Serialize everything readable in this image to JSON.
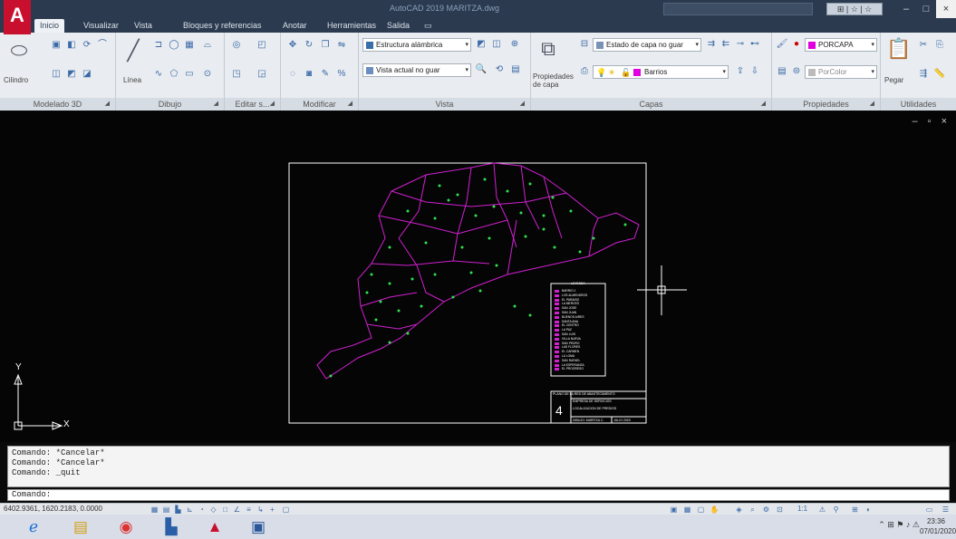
{
  "window": {
    "title": "AutoCAD 2019 MARITZA.dwg",
    "app_logo": "A",
    "minimize": "–",
    "maximize": "□",
    "close": "×",
    "search_placeholder": "",
    "help_icons": "⊞ | ☆ | ☆"
  },
  "tabs": [
    {
      "label": "Inicio",
      "active": true
    },
    {
      "label": "Visualizar",
      "active": false
    },
    {
      "label": "Vista",
      "active": false
    },
    {
      "label": "Bloques y referencias",
      "active": false
    },
    {
      "label": "Anotar",
      "active": false
    },
    {
      "label": "Herramientas",
      "active": false
    },
    {
      "label": "Salida",
      "active": false
    },
    {
      "label": "▭",
      "active": false
    }
  ],
  "ribbon": {
    "panels": [
      {
        "title": "Modelado 3D"
      },
      {
        "title": "Dibujo"
      },
      {
        "title": "Editar s..."
      },
      {
        "title": "Modificar"
      },
      {
        "title": "Vista"
      },
      {
        "title": "Capas"
      },
      {
        "title": "Propiedades"
      },
      {
        "title": "Utilidades"
      }
    ],
    "cilindro_label": "Cilindro",
    "linea_label": "Línea",
    "visual_style": "Estructura alámbrica",
    "named_view": "Vista actual no guar",
    "layer_state": "Estado de capa no guar",
    "current_layer": "Barrios",
    "layer_props_label": "Propiedades de capa",
    "color_combo": "PORCAPA",
    "linetype_combo": "PorColor",
    "pegar_label": "Pegar",
    "accent_color": "#c8102e",
    "layer_color": "#e000e0"
  },
  "drawing": {
    "background": "#050505",
    "sheet_border_color": "#ffffff",
    "boundary_color": "#d020d0",
    "point_color": "#30e050",
    "legend_title": "LEYENDA",
    "legend_rows": [
      "BARRIO 1",
      "LOS ALMENDROS",
      "EL PARAISO",
      "LA MERCED",
      "SAN JOSE",
      "SAN JUAN",
      "BUENOS AIRES",
      "SANTA ANA",
      "EL CENTRO",
      "LA PAZ",
      "SAN LUIS",
      "VILLA NUEVA",
      "SAN PEDRO",
      "LAS FLORES",
      "EL CARMEN",
      "LA LOMA",
      "SAN RAFAEL",
      "LA ESPERANZA",
      "EL PROGRESO"
    ],
    "title_block_number": "4",
    "title_block_line1": "PLANO DE LA RED DE ABASTECIMIENTO",
    "title_block_line2": "EMPRESA DE SERVICIOS",
    "title_block_line3": "LOCALIZACION DE PREDIOS",
    "title_block_line4": "DIBUJO: MARITZA C.",
    "title_block_line5": "JULIO 2020",
    "ucs_y": "Y",
    "ucs_x": "X",
    "viewport_controls": "– ▫ ×"
  },
  "command": {
    "history": [
      "Comando: *Cancelar*",
      "Comando: *Cancelar*",
      "Comando: _quit"
    ],
    "prompt": "Comando:"
  },
  "status": {
    "coordinates": "6402.9361, 1620.2183, 0.0000",
    "scale": "1:1"
  },
  "taskbar": {
    "apps": [
      "edge-icon",
      "file-explorer-icon",
      "chrome-icon",
      "store-icon",
      "autocad-icon",
      "word-icon"
    ],
    "time": "23:36",
    "date": "07/01/2020"
  }
}
